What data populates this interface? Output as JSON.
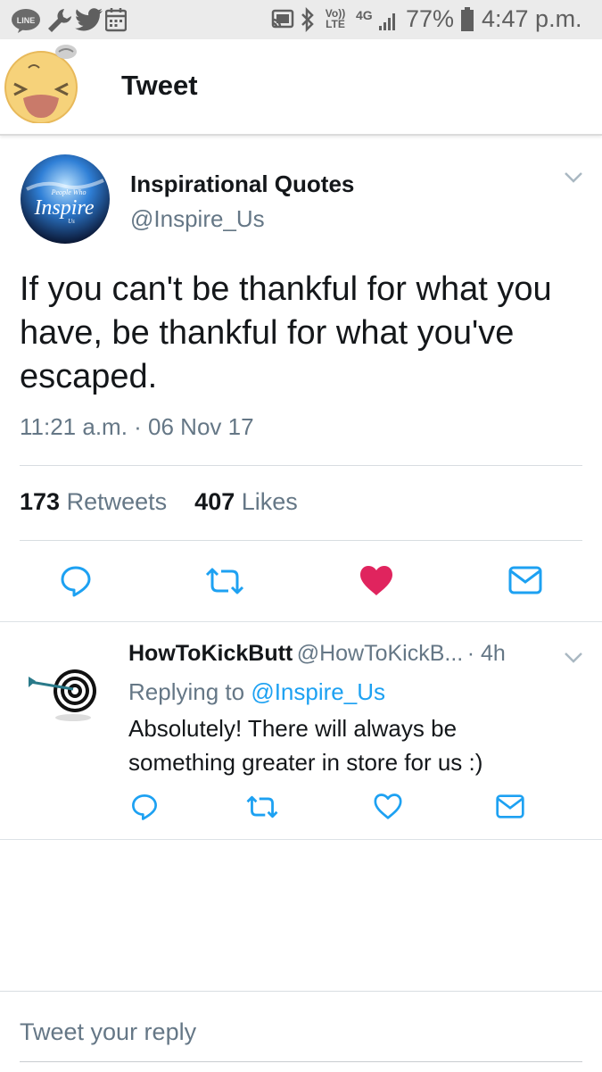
{
  "status_bar": {
    "battery": "77%",
    "time": "4:47 p.m.",
    "network": "4G",
    "volte": "Vo)) LTE",
    "left_icons": [
      "line-icon",
      "wrench-icon",
      "twitter-bird-icon",
      "calendar-icon"
    ],
    "right_icons": [
      "cast-icon",
      "bluetooth-icon",
      "volte-icon",
      "signal-icon",
      "battery-icon"
    ]
  },
  "header": {
    "title": "Tweet"
  },
  "tweet": {
    "author_name": "Inspirational Quotes",
    "author_handle": "@Inspire_Us",
    "avatar_text": "Inspire",
    "avatar_small_top": "People Who",
    "avatar_small_bottom": "Us",
    "text": "If you can't be thankful for what you have, be thankful for what you've escaped.",
    "timestamp": "11:21 a.m. · 06 Nov 17",
    "retweet_count": "173",
    "retweet_label": "Retweets",
    "like_count": "407",
    "like_label": "Likes",
    "liked": true
  },
  "reply": {
    "author_name": "HowToKickButt",
    "author_handle": "@HowToKickB...",
    "age": "· 4h",
    "replying_prefix": "Replying to",
    "replying_to": "@Inspire_Us",
    "text_line1": "Absolutely! There will always be",
    "text_line2": "something greater in store for us :)"
  },
  "composer": {
    "placeholder": "Tweet your reply"
  },
  "colors": {
    "accent": "#1da1f2",
    "like": "#e0245e",
    "muted": "#657786",
    "icon": "#1da1f2"
  }
}
